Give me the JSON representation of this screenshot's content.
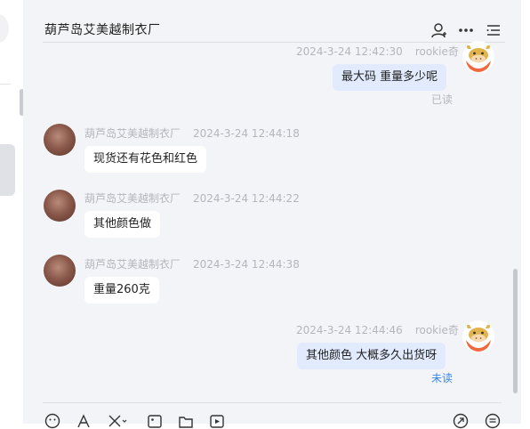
{
  "header": {
    "title": "葫芦岛艾美越制衣厂",
    "icons": [
      "user-icon",
      "more-icon",
      "list-icon"
    ]
  },
  "messages": [
    {
      "side": "out",
      "time": "2024-3-24 12:42:30",
      "sender": "rookie奇",
      "text": "最大码  重量多少呢",
      "status": "已读"
    },
    {
      "side": "in",
      "sender": "葫芦岛艾美越制衣厂",
      "time": "2024-3-24 12:44:18",
      "text": "现货还有花色和红色"
    },
    {
      "side": "in",
      "sender": "葫芦岛艾美越制衣厂",
      "time": "2024-3-24 12:44:22",
      "text": "其他颜色做"
    },
    {
      "side": "in",
      "sender": "葫芦岛艾美越制衣厂",
      "time": "2024-3-24 12:44:38",
      "text": "重量260克"
    },
    {
      "side": "out",
      "time": "2024-3-24 12:44:46",
      "sender": "rookie奇",
      "text": "其他颜色  大概多久出货呀",
      "status": "未读"
    }
  ],
  "toolbar": {
    "icons": [
      "emoji-icon",
      "font-icon",
      "scissors-icon",
      "image-icon",
      "folder-icon",
      "video-icon",
      "share-icon",
      "quick-reply-icon"
    ]
  },
  "colors": {
    "chat_bg": "#f3f4f7",
    "outgoing_bubble": "#e1ebfd",
    "incoming_bubble": "#ffffff",
    "unread": "#3d86e6"
  }
}
